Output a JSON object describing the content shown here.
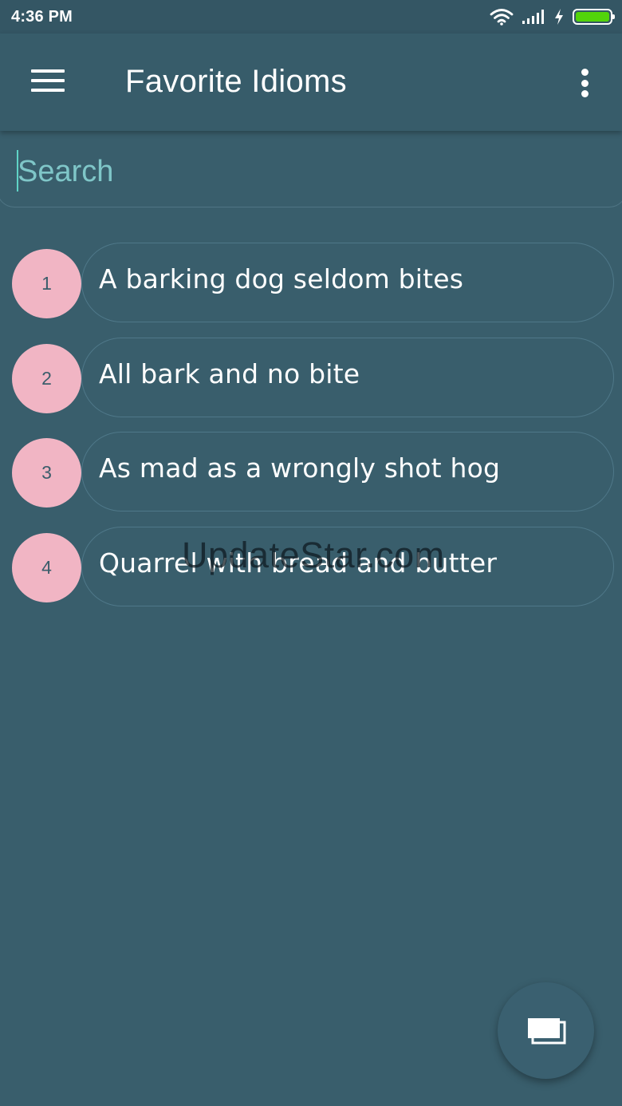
{
  "status_bar": {
    "time": "4:36 PM",
    "icons": [
      "wifi-icon",
      "signal-icon",
      "charging-icon",
      "battery-icon"
    ],
    "battery_level": 1.0,
    "battery_color": "#52d40a"
  },
  "app_bar": {
    "title": "Favorite Idioms",
    "menu_icon": "hamburger-menu-icon",
    "overflow_icon": "more-vertical-icon"
  },
  "search": {
    "placeholder": "Search",
    "value": ""
  },
  "idioms": [
    {
      "number": "1",
      "text": "A barking dog seldom bites"
    },
    {
      "number": "2",
      "text": "All bark and no bite"
    },
    {
      "number": "3",
      "text": "As mad as a wrongly shot hog"
    },
    {
      "number": "4",
      "text": "Quarrel with bread and butter"
    }
  ],
  "watermark": "UpdateStar.com",
  "fab": {
    "icon": "cards-stack-icon"
  },
  "colors": {
    "background": "#395e6c",
    "badge": "#f1b5c4",
    "accent": "#5fd3c6"
  }
}
